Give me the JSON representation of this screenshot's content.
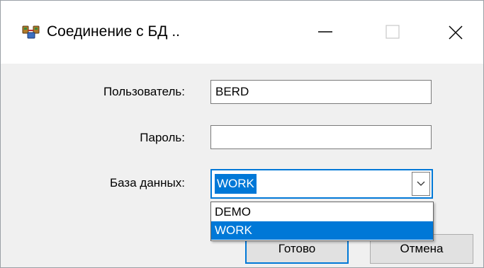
{
  "window": {
    "title": "Соединение с БД ..",
    "icon": "database-connection-icon",
    "controls": [
      "minimize-icon",
      "maximize-icon",
      "close-icon"
    ]
  },
  "form": {
    "user_label": "Пользователь:",
    "user_value": "BERD",
    "password_label": "Пароль:",
    "password_value": "",
    "database_label": "База данных:",
    "database_selected": "WORK"
  },
  "dropdown": {
    "options": [
      "DEMO",
      "WORK"
    ],
    "highlighted": "WORK"
  },
  "buttons": {
    "ok_label": "Готово",
    "cancel_label": "Отмена"
  },
  "colors": {
    "accent": "#0078d7",
    "background": "#f0f0f0",
    "titlebar": "#ffffff"
  }
}
